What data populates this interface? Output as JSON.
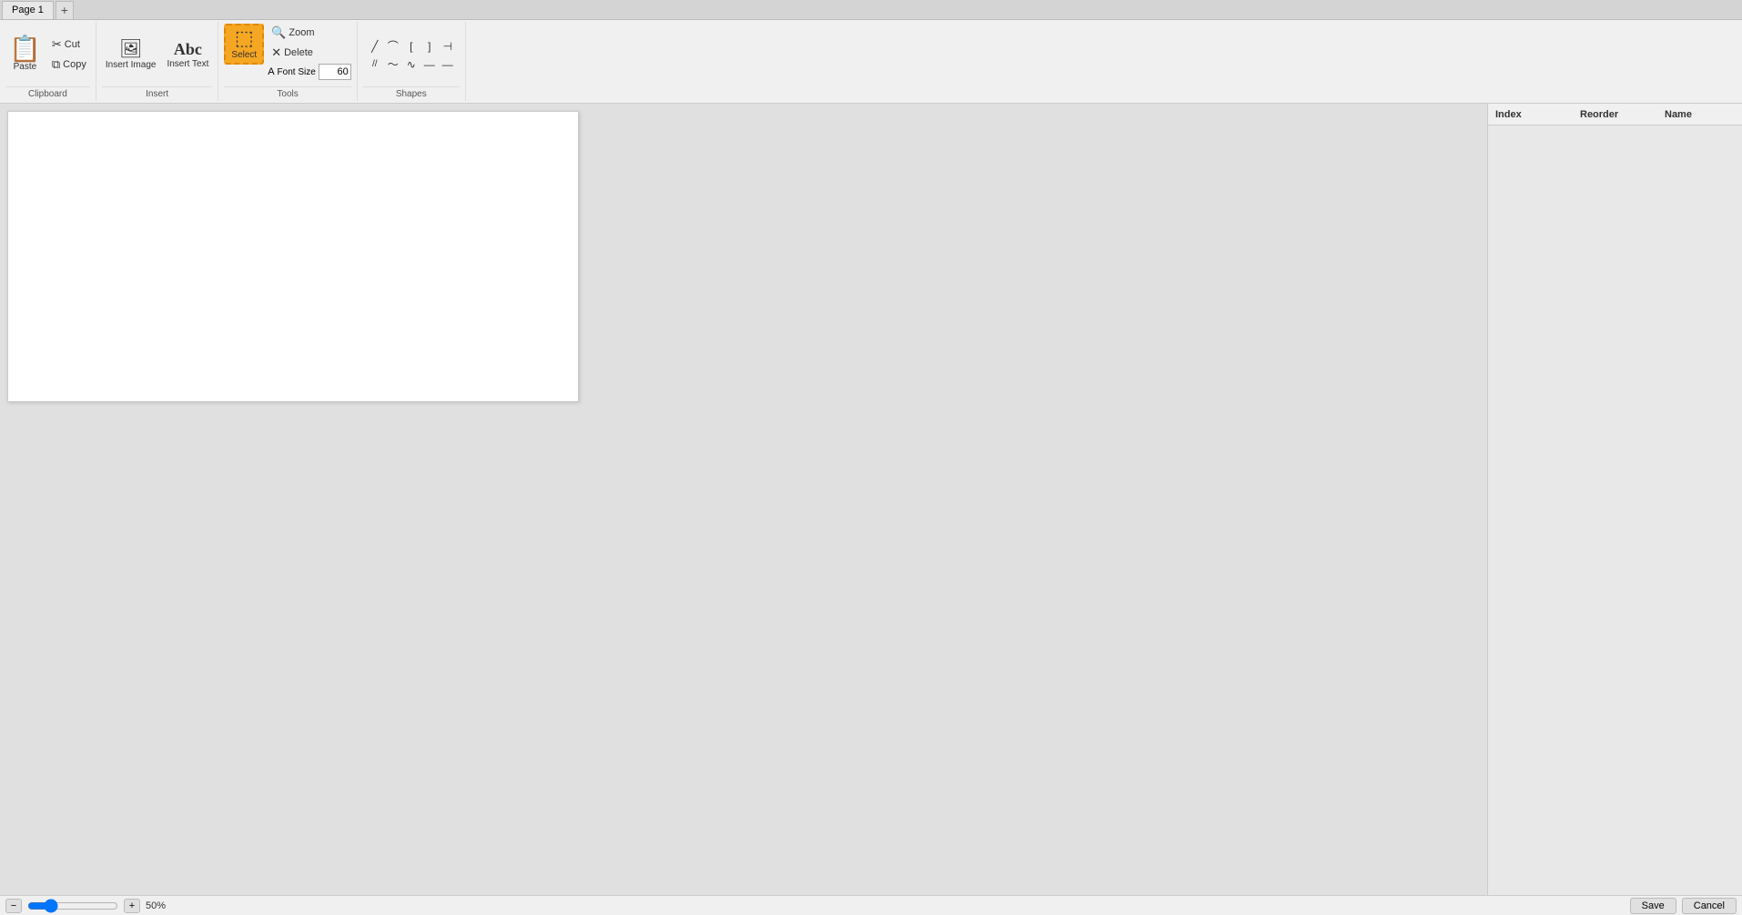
{
  "tabs": [
    {
      "label": "Page 1",
      "active": true
    }
  ],
  "tab_add_label": "+",
  "ribbon": {
    "clipboard": {
      "label": "Clipboard",
      "paste_label": "Paste",
      "cut_label": "Cut",
      "copy_label": "Copy"
    },
    "insert": {
      "label": "Insert",
      "insert_image_label": "Insert Image",
      "insert_text_label": "Insert Text"
    },
    "tools": {
      "label": "Tools",
      "select_label": "Select",
      "zoom_label": "Zoom",
      "delete_label": "Delete",
      "font_size_label": "Font Size",
      "font_size_value": "60"
    },
    "shapes": {
      "label": "Shapes",
      "items": [
        "╱",
        "⌒",
        "[",
        "]",
        "⊢",
        "╱╱",
        "〜",
        "∿",
        "—",
        "—"
      ]
    }
  },
  "right_panel": {
    "col_index": "Index",
    "col_reorder": "Reorder",
    "col_name": "Name"
  },
  "status_bar": {
    "zoom_level": "50%",
    "save_label": "Save",
    "cancel_label": "Cancel"
  },
  "canvas": {
    "background": "#ffffff"
  }
}
